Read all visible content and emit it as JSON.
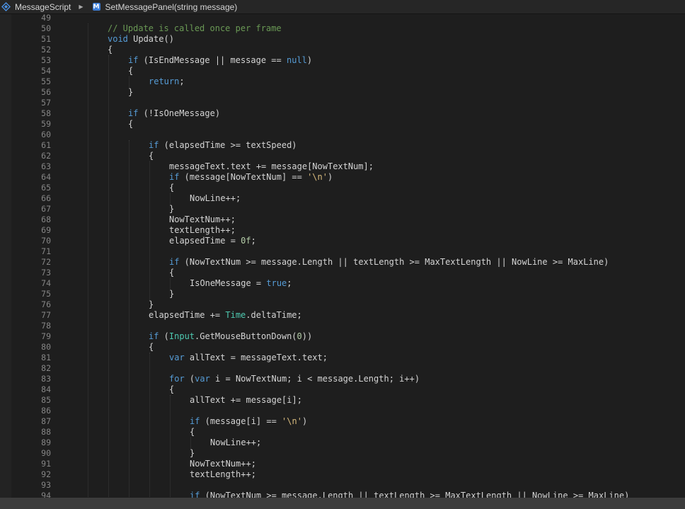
{
  "breadcrumb": {
    "class_name": "MessageScript",
    "class_icon": "csharp-class-icon",
    "separator": "▶",
    "method_icon_letter": "M",
    "method_name": "SetMessagePanel(string message)"
  },
  "colors": {
    "background": "#1e1e1e",
    "keyword": "#569cd6",
    "comment": "#6a9955",
    "string": "#d7ba7d",
    "number": "#b5cea8",
    "type": "#4ec9b0",
    "text": "#d4d4d4",
    "line_number": "#858585"
  },
  "code": {
    "lines": [
      {
        "num": "49",
        "indent": 0,
        "tokens": []
      },
      {
        "num": "50",
        "indent": 2,
        "tokens": [
          {
            "t": "cm",
            "v": "// Update is called once per frame"
          }
        ]
      },
      {
        "num": "51",
        "indent": 2,
        "tokens": [
          {
            "t": "kw",
            "v": "void"
          },
          {
            "t": "plain",
            "v": " Update()"
          }
        ]
      },
      {
        "num": "52",
        "indent": 2,
        "tokens": [
          {
            "t": "plain",
            "v": "{"
          }
        ]
      },
      {
        "num": "53",
        "indent": 3,
        "tokens": [
          {
            "t": "kw",
            "v": "if"
          },
          {
            "t": "plain",
            "v": " (IsEndMessage || message == "
          },
          {
            "t": "kw",
            "v": "null"
          },
          {
            "t": "plain",
            "v": ")"
          }
        ]
      },
      {
        "num": "54",
        "indent": 3,
        "tokens": [
          {
            "t": "plain",
            "v": "{"
          }
        ]
      },
      {
        "num": "55",
        "indent": 4,
        "tokens": [
          {
            "t": "kw",
            "v": "return"
          },
          {
            "t": "plain",
            "v": ";"
          }
        ]
      },
      {
        "num": "56",
        "indent": 3,
        "tokens": [
          {
            "t": "plain",
            "v": "}"
          }
        ]
      },
      {
        "num": "57",
        "indent": 0,
        "tokens": []
      },
      {
        "num": "58",
        "indent": 3,
        "tokens": [
          {
            "t": "kw",
            "v": "if"
          },
          {
            "t": "plain",
            "v": " (!IsOneMessage)"
          }
        ]
      },
      {
        "num": "59",
        "indent": 3,
        "tokens": [
          {
            "t": "plain",
            "v": "{"
          }
        ]
      },
      {
        "num": "60",
        "indent": 0,
        "tokens": []
      },
      {
        "num": "61",
        "indent": 4,
        "tokens": [
          {
            "t": "kw",
            "v": "if"
          },
          {
            "t": "plain",
            "v": " (elapsedTime >= textSpeed)"
          }
        ]
      },
      {
        "num": "62",
        "indent": 4,
        "tokens": [
          {
            "t": "plain",
            "v": "{"
          }
        ]
      },
      {
        "num": "63",
        "indent": 5,
        "tokens": [
          {
            "t": "plain",
            "v": "messageText.text += message[NowTextNum];"
          }
        ]
      },
      {
        "num": "64",
        "indent": 5,
        "tokens": [
          {
            "t": "kw",
            "v": "if"
          },
          {
            "t": "plain",
            "v": " (message[NowTextNum] == "
          },
          {
            "t": "str",
            "v": "'\\n'"
          },
          {
            "t": "plain",
            "v": ")"
          }
        ]
      },
      {
        "num": "65",
        "indent": 5,
        "tokens": [
          {
            "t": "plain",
            "v": "{"
          }
        ]
      },
      {
        "num": "66",
        "indent": 6,
        "tokens": [
          {
            "t": "plain",
            "v": "NowLine++;"
          }
        ]
      },
      {
        "num": "67",
        "indent": 5,
        "tokens": [
          {
            "t": "plain",
            "v": "}"
          }
        ]
      },
      {
        "num": "68",
        "indent": 5,
        "tokens": [
          {
            "t": "plain",
            "v": "NowTextNum++;"
          }
        ]
      },
      {
        "num": "69",
        "indent": 5,
        "tokens": [
          {
            "t": "plain",
            "v": "textLength++;"
          }
        ]
      },
      {
        "num": "70",
        "indent": 5,
        "tokens": [
          {
            "t": "plain",
            "v": "elapsedTime = "
          },
          {
            "t": "num",
            "v": "0f"
          },
          {
            "t": "plain",
            "v": ";"
          }
        ]
      },
      {
        "num": "71",
        "indent": 0,
        "tokens": []
      },
      {
        "num": "72",
        "indent": 5,
        "tokens": [
          {
            "t": "kw",
            "v": "if"
          },
          {
            "t": "plain",
            "v": " (NowTextNum >= message.Length || textLength >= MaxTextLength || NowLine >= MaxLine)"
          }
        ]
      },
      {
        "num": "73",
        "indent": 5,
        "tokens": [
          {
            "t": "plain",
            "v": "{"
          }
        ]
      },
      {
        "num": "74",
        "indent": 6,
        "tokens": [
          {
            "t": "plain",
            "v": "IsOneMessage = "
          },
          {
            "t": "kw",
            "v": "true"
          },
          {
            "t": "plain",
            "v": ";"
          }
        ]
      },
      {
        "num": "75",
        "indent": 5,
        "tokens": [
          {
            "t": "plain",
            "v": "}"
          }
        ]
      },
      {
        "num": "76",
        "indent": 4,
        "tokens": [
          {
            "t": "plain",
            "v": "}"
          }
        ]
      },
      {
        "num": "77",
        "indent": 4,
        "tokens": [
          {
            "t": "plain",
            "v": "elapsedTime += "
          },
          {
            "t": "type",
            "v": "Time"
          },
          {
            "t": "plain",
            "v": ".deltaTime;"
          }
        ]
      },
      {
        "num": "78",
        "indent": 0,
        "tokens": []
      },
      {
        "num": "79",
        "indent": 4,
        "tokens": [
          {
            "t": "kw",
            "v": "if"
          },
          {
            "t": "plain",
            "v": " ("
          },
          {
            "t": "type",
            "v": "Input"
          },
          {
            "t": "plain",
            "v": ".GetMouseButtonDown("
          },
          {
            "t": "num",
            "v": "0"
          },
          {
            "t": "plain",
            "v": "))"
          }
        ]
      },
      {
        "num": "80",
        "indent": 4,
        "tokens": [
          {
            "t": "plain",
            "v": "{"
          }
        ]
      },
      {
        "num": "81",
        "indent": 5,
        "tokens": [
          {
            "t": "kw",
            "v": "var"
          },
          {
            "t": "plain",
            "v": " allText = messageText.text;"
          }
        ]
      },
      {
        "num": "82",
        "indent": 0,
        "tokens": []
      },
      {
        "num": "83",
        "indent": 5,
        "tokens": [
          {
            "t": "kw",
            "v": "for"
          },
          {
            "t": "plain",
            "v": " ("
          },
          {
            "t": "kw",
            "v": "var"
          },
          {
            "t": "plain",
            "v": " i = NowTextNum; i < message.Length; i++)"
          }
        ]
      },
      {
        "num": "84",
        "indent": 5,
        "tokens": [
          {
            "t": "plain",
            "v": "{"
          }
        ]
      },
      {
        "num": "85",
        "indent": 6,
        "tokens": [
          {
            "t": "plain",
            "v": "allText += message[i];"
          }
        ]
      },
      {
        "num": "86",
        "indent": 0,
        "tokens": []
      },
      {
        "num": "87",
        "indent": 6,
        "tokens": [
          {
            "t": "kw",
            "v": "if"
          },
          {
            "t": "plain",
            "v": " (message[i] == "
          },
          {
            "t": "str",
            "v": "'\\n'"
          },
          {
            "t": "plain",
            "v": ")"
          }
        ]
      },
      {
        "num": "88",
        "indent": 6,
        "tokens": [
          {
            "t": "plain",
            "v": "{"
          }
        ]
      },
      {
        "num": "89",
        "indent": 7,
        "tokens": [
          {
            "t": "plain",
            "v": "NowLine++;"
          }
        ]
      },
      {
        "num": "90",
        "indent": 6,
        "tokens": [
          {
            "t": "plain",
            "v": "}"
          }
        ]
      },
      {
        "num": "91",
        "indent": 6,
        "tokens": [
          {
            "t": "plain",
            "v": "NowTextNum++;"
          }
        ]
      },
      {
        "num": "92",
        "indent": 6,
        "tokens": [
          {
            "t": "plain",
            "v": "textLength++;"
          }
        ]
      },
      {
        "num": "93",
        "indent": 0,
        "tokens": []
      },
      {
        "num": "94",
        "indent": 6,
        "tokens": [
          {
            "t": "kw",
            "v": "if"
          },
          {
            "t": "plain",
            "v": " (NowTextNum >= message.Length || textLength >= MaxTextLength || NowLine >= MaxLine)"
          }
        ]
      }
    ]
  }
}
